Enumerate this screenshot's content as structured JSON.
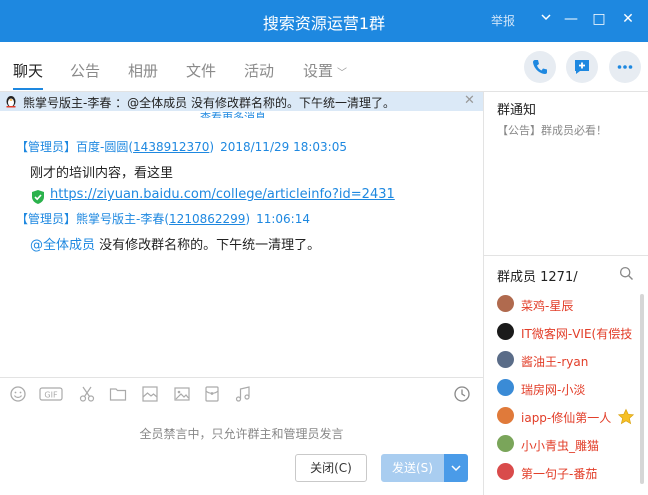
{
  "window": {
    "title": "搜索资源运营1群",
    "report_label": "举报",
    "minimize_glyph": "—",
    "maximize_glyph": "□",
    "close_glyph": "✕"
  },
  "tabs": [
    {
      "label": "聊天",
      "active": true
    },
    {
      "label": "公告"
    },
    {
      "label": "相册"
    },
    {
      "label": "文件"
    },
    {
      "label": "活动"
    },
    {
      "label": "设置"
    }
  ],
  "notice": {
    "text": "熊掌号版主-李春 ：@全体成员 没有修改群名称的。下午统一清理了。"
  },
  "load_more": "查看更多消息",
  "messages": [
    {
      "role": "【管理员】",
      "sender": "百度-圆圆",
      "uid_open": "(",
      "uid": "1438912370",
      "uid_close": ")",
      "time": "2018/11/29 18:03:05",
      "lines": [
        "刚才的培训内容，看这里"
      ],
      "link": "https://ziyuan.baidu.com/college/articleinfo?id=2431"
    },
    {
      "role": "【管理员】",
      "sender": "熊掌号版主-李春",
      "uid_open": "(",
      "uid": "1210862299",
      "uid_close": ")",
      "time": "11:06:14",
      "mention": "@全体成员",
      "text": " 没有修改群名称的。下午统一清理了。"
    }
  ],
  "composer": {
    "muted_note": "全员禁言中，只允许群主和管理员发言",
    "close_button": "关闭(C)",
    "send_button": "发送(S)"
  },
  "right_panel": {
    "notice_title": "群通知",
    "notice_sub": "【公告】群成员必看！",
    "members_title": "群成员 1271/",
    "members": [
      {
        "name": "菜鸡-星辰"
      },
      {
        "name": "IT微客网-VIE(有偿技"
      },
      {
        "name": "酱油王-ryan"
      },
      {
        "name": "瑞房网-小淡"
      },
      {
        "name": "iapp-修仙第一人"
      },
      {
        "name": "小小青虫_雕猫"
      },
      {
        "name": "第一句子-番茄"
      }
    ]
  },
  "colors": {
    "accent": "#1e88e0",
    "member_name": "#e23d28"
  }
}
